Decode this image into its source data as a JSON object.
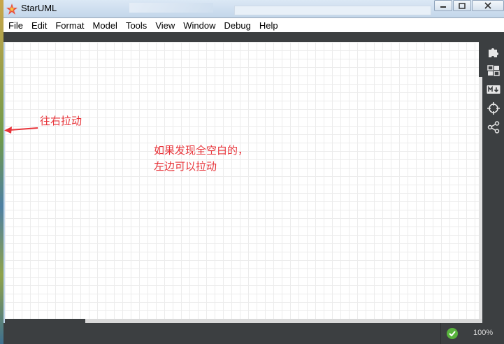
{
  "window": {
    "title": "StarUML",
    "controls": [
      "minimize",
      "maximize",
      "close"
    ]
  },
  "menu": {
    "items": [
      "File",
      "Edit",
      "Format",
      "Model",
      "Tools",
      "View",
      "Window",
      "Debug",
      "Help"
    ]
  },
  "annotations": {
    "drag_right": "往右拉动",
    "hint_line1": "如果发现全空白的，",
    "hint_line2": "左边可以拉动"
  },
  "right_toolbar": {
    "icons": [
      "extensions-icon",
      "layout-icon",
      "markdown-icon",
      "crosshair-icon",
      "share-icon"
    ]
  },
  "status": {
    "validation": "ok",
    "zoom": "100%"
  },
  "colors": {
    "annotation": "#e8343a",
    "dark_panel": "#3c3f41",
    "ok_green": "#58b33c"
  }
}
